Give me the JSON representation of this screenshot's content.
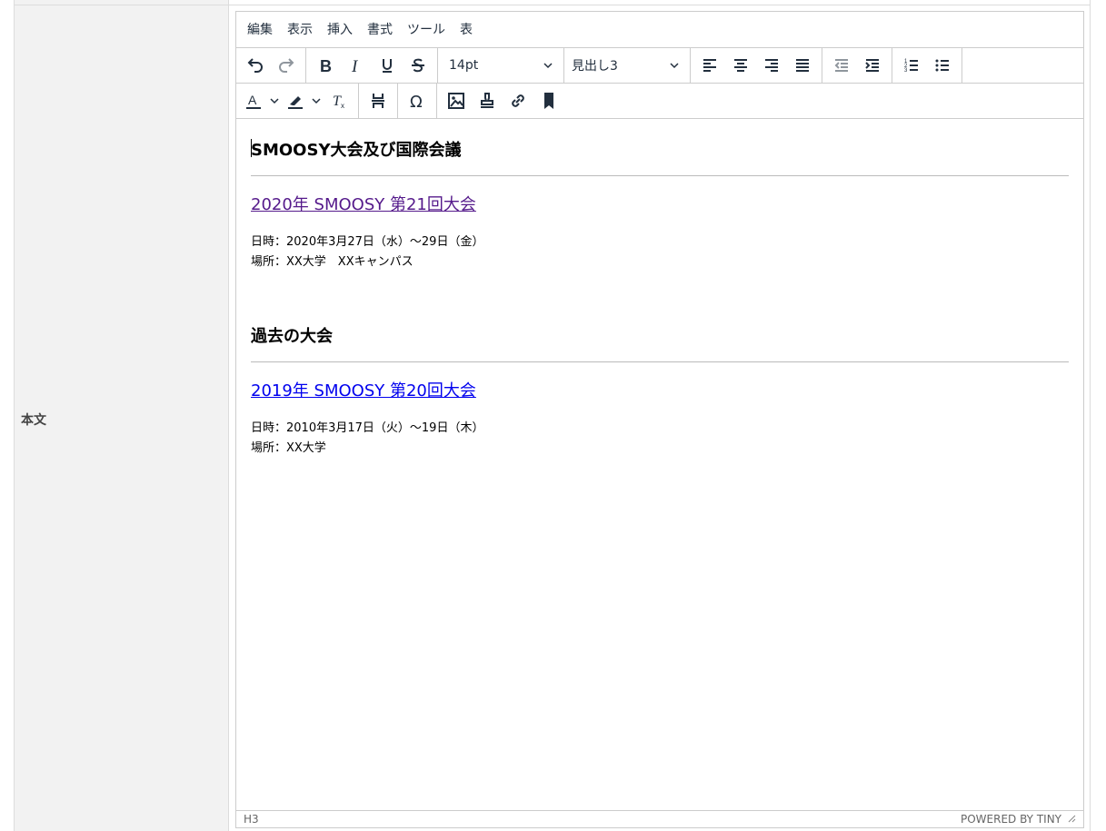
{
  "form": {
    "field_label": "本文"
  },
  "menubar": {
    "items": [
      "編集",
      "表示",
      "挿入",
      "書式",
      "ツール",
      "表"
    ]
  },
  "toolbar": {
    "font_size": "14pt",
    "block_format": "見出し3"
  },
  "content": {
    "heading1": "SMOOSY大会及び国際会議",
    "event1": {
      "link": "2020年 SMOOSY 第21回大会",
      "date": "日時：2020年3月27日（水）～29日（金）",
      "place": "場所：XX大学　XXキャンパス"
    },
    "heading2": "過去の大会",
    "event2": {
      "link": "2019年 SMOOSY 第20回大会",
      "date": "日時：2010年3月17日（火）～19日（木）",
      "place": "場所：XX大学"
    }
  },
  "statusbar": {
    "path": "H3",
    "branding": "POWERED BY TINY"
  },
  "colors": {
    "text_color_bar": "#222f3e",
    "highlight_bar": "#222f3e",
    "visited_link": "#551a8b",
    "link": "#0000ee"
  }
}
